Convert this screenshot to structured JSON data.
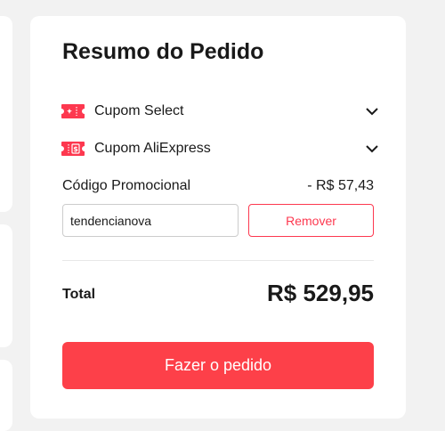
{
  "summary": {
    "title": "Resumo do Pedido",
    "coupons": [
      {
        "label": "Cupom Select",
        "icon": "coupon-select-icon"
      },
      {
        "label": "Cupom AliExpress",
        "icon": "coupon-aliexpress-icon"
      }
    ],
    "promo": {
      "label": "Código Promocional",
      "discount": "- R$ 57,43",
      "input_value": "tendencianova",
      "remove_label": "Remover"
    },
    "total": {
      "label": "Total",
      "value": "R$ 529,95"
    },
    "order_button_label": "Fazer o pedido"
  },
  "colors": {
    "accent": "#fd384f",
    "order_button": "#fd4049",
    "text": "#191919",
    "background": "#f2f2f2"
  }
}
